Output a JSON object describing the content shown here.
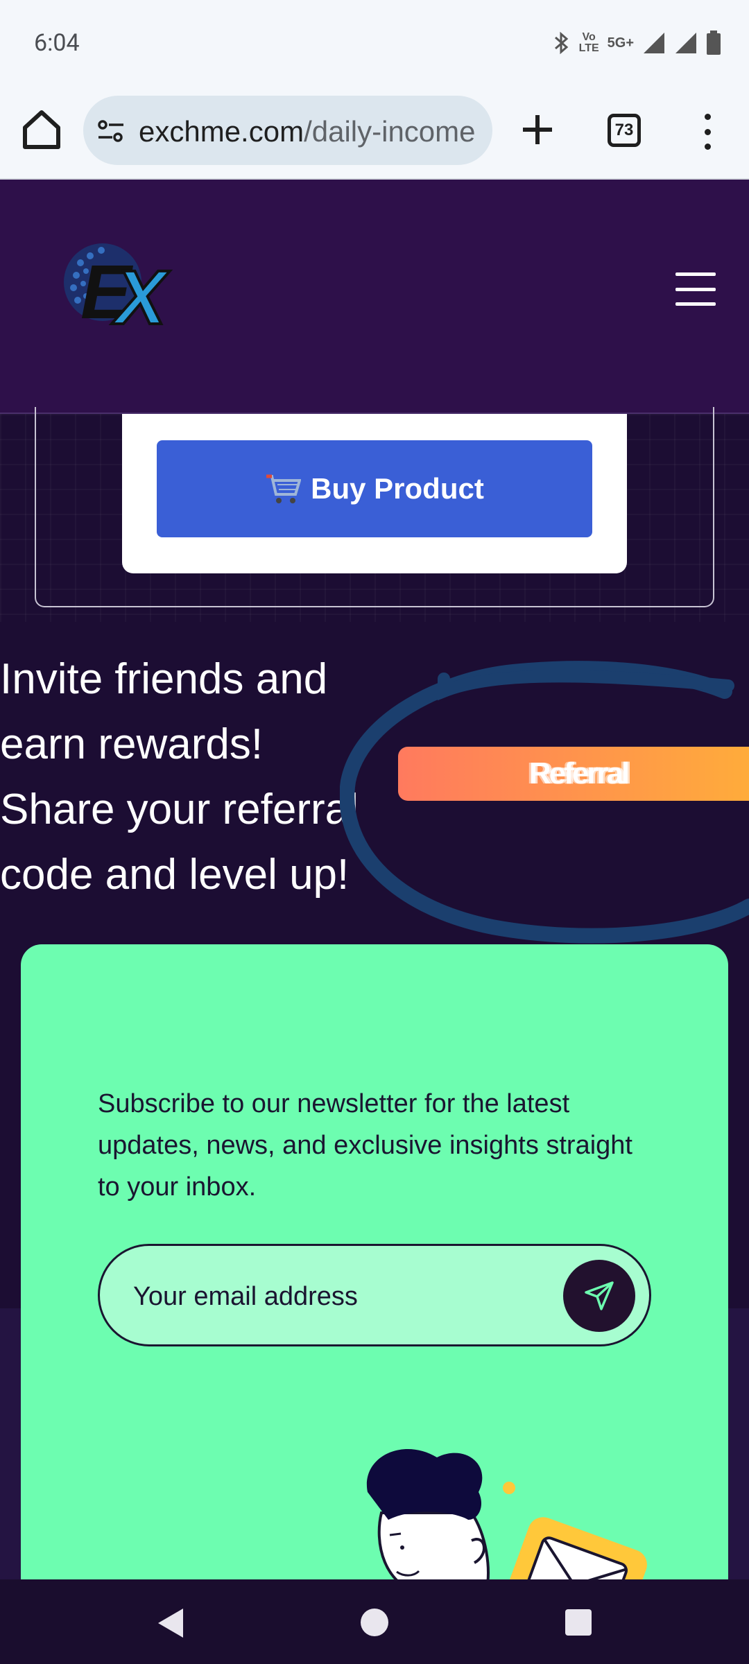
{
  "status_bar": {
    "time": "6:04",
    "network_top": "Vo",
    "network_bottom": "LTE",
    "network_5g": "5G+",
    "icons": [
      "bluetooth-icon",
      "volte-icon",
      "signal-icon",
      "signal-icon",
      "battery-icon"
    ]
  },
  "browser": {
    "url_domain": "exchme.com",
    "url_path": "/daily-income",
    "tab_count": "73",
    "icons": [
      "home-icon",
      "site-settings-icon",
      "new-tab-icon",
      "tabs-icon",
      "more-icon"
    ]
  },
  "header": {
    "logo_text": "EX",
    "icons": [
      "logo",
      "hamburger-menu-icon"
    ]
  },
  "product": {
    "buy_label": "Buy Product",
    "buy_icon": "cart-icon"
  },
  "invite": {
    "text": "Invite friends and earn rewards! Share your referral code and level up!",
    "badge_label": "Referral"
  },
  "newsletter": {
    "text": "Subscribe to our newsletter for the latest updates, news, and exclusive insights straight to your inbox.",
    "email_placeholder": "Your email address",
    "send_icon": "send-icon"
  },
  "colors": {
    "header_bg": "#2e104a",
    "page_bg": "#1c0d33",
    "buy_button": "#3a5fd6",
    "newsletter_bg": "#6dfdb0",
    "referral_gradient": [
      "#ff7a5e",
      "#ffad3a"
    ],
    "scribble": "#1b3f6e"
  }
}
